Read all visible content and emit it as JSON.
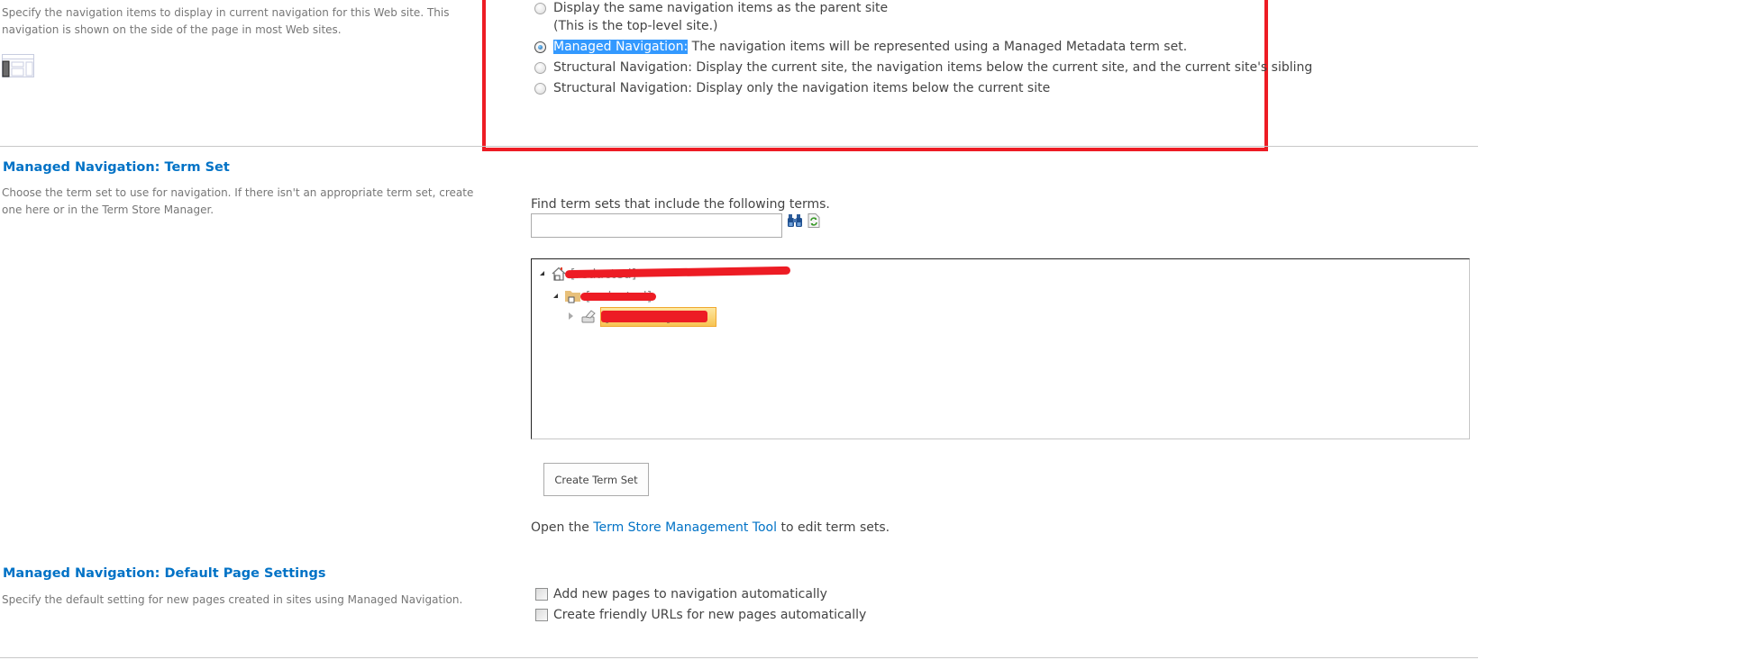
{
  "current_navigation": {
    "description": "Specify the navigation items to display in current navigation for this Web site. This navigation is shown on the side of the page in most Web sites.",
    "preview_icon": "navigation-layout-icon",
    "options": [
      {
        "label": "Display the same navigation items as the parent site",
        "sub": "(This is the top-level site.)",
        "selected": false
      },
      {
        "label_highlight": "Managed Navigation:",
        "label": " The navigation items will be represented using a Managed Metadata term set.",
        "selected": true
      },
      {
        "label": "Structural Navigation: Display the current site, the navigation items below the current site, and the current site's sibling",
        "selected": false
      },
      {
        "label": "Structural Navigation: Display only the navigation items below the current site",
        "selected": false
      }
    ],
    "annotation_color": "#ed1c24"
  },
  "term_set": {
    "heading": "Managed Navigation: Term Set",
    "description": "Choose the term set to use for navigation. If there isn't an appropriate term set, create one here or in the Term Store Manager.",
    "find_label": "Find term sets that include the following terms.",
    "find_value": "",
    "search_icon": "binoculars-icon",
    "refresh_icon": "refresh-icon",
    "tree": [
      {
        "level": 0,
        "expanded": true,
        "icon": "term-store-icon",
        "label": "[redacted]"
      },
      {
        "level": 1,
        "expanded": true,
        "icon": "term-group-icon",
        "label": "[redacted]"
      },
      {
        "level": 2,
        "expanded": false,
        "icon": "term-set-icon",
        "label": "[redacted]",
        "selected": true
      }
    ],
    "create_button": "Create Term Set",
    "open_prefix": "Open the ",
    "open_link": "Term Store Management Tool",
    "open_suffix": " to edit term sets."
  },
  "default_page_settings": {
    "heading": "Managed Navigation: Default Page Settings",
    "description": "Specify the default setting for new pages created in sites using Managed Navigation.",
    "checkboxes": [
      {
        "label": "Add new pages to navigation automatically",
        "checked": false
      },
      {
        "label": "Create friendly URLs for new pages automatically",
        "checked": false
      }
    ]
  },
  "colors": {
    "accent": "#0072c6",
    "selection": "#3399ff",
    "annotation": "#ed1c24",
    "tree_selected": "#fbd46e"
  }
}
